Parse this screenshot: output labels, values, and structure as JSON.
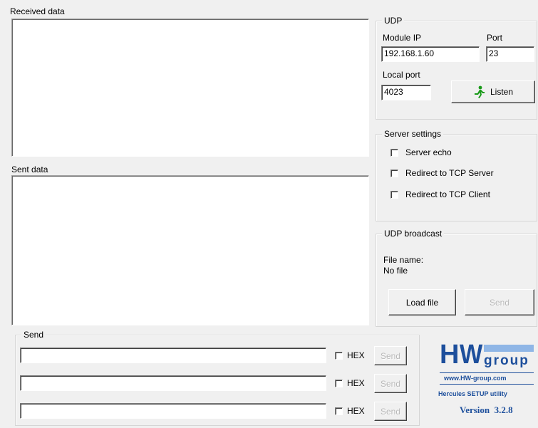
{
  "received": {
    "label": "Received data"
  },
  "sent": {
    "label": "Sent data"
  },
  "udp": {
    "title": "UDP",
    "module_ip_label": "Module IP",
    "port_label": "Port",
    "module_ip_value": "192.168.1.60",
    "port_value": "23",
    "local_port_label": "Local port",
    "local_port_value": "4023",
    "listen_label": "Listen"
  },
  "server_settings": {
    "title": "Server settings",
    "options": [
      "Server echo",
      "Redirect to TCP Server",
      "Redirect to TCP Client"
    ]
  },
  "broadcast": {
    "title": "UDP broadcast",
    "file_name_label": "File name:",
    "file_name_value": "No file",
    "load_label": "Load file",
    "send_label": "Send"
  },
  "send": {
    "title": "Send",
    "rows": [
      {
        "value": "",
        "hex_label": "HEX",
        "send_label": "Send"
      },
      {
        "value": "",
        "hex_label": "HEX",
        "send_label": "Send"
      },
      {
        "value": "",
        "hex_label": "HEX",
        "send_label": "Send"
      }
    ]
  },
  "logo": {
    "brand_h": "H",
    "brand_w": "W",
    "brand_group": "group",
    "url": "www.HW-group.com",
    "tagline": "Hercules SETUP utility",
    "version": "Version  3.2.8",
    "brand_color": "#1d4f9c",
    "accent_color": "#8fb6e6"
  },
  "colors": {
    "listen_icon": "#1a9a1a"
  }
}
